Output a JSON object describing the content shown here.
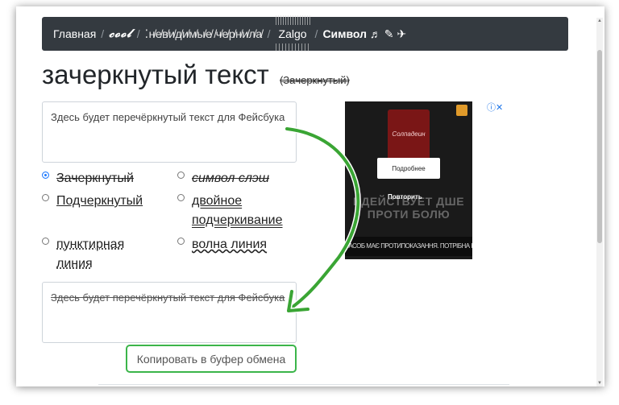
{
  "nav": {
    "home": "Главная",
    "sep": "/",
    "cool": "𝓬𝓸𝓸𝓵",
    "invisible_ink": "⁚н̸е̸в̸и̸д̸и̸м̸ы̸е̸ ̸ч̸е̸р̸н̸и̸л̸а̸",
    "zalgo": "Zalgo",
    "symbol": "Символ ♬ ✎ ✈"
  },
  "page": {
    "title": "зачеркнутый текст",
    "subtitle": "(̶З̶а̶ч̶е̶р̶к̶н̶у̶т̶ы̶й̶)"
  },
  "input": {
    "value": "Здесь будет перечёркнутый текст для Фейсбука"
  },
  "options": [
    {
      "label": "Зачеркнутый",
      "checked": true
    },
    {
      "label": "символ слэш",
      "checked": false
    },
    {
      "label": "Подчеркнутый",
      "checked": false
    },
    {
      "label": "двойное подчеркивание",
      "checked": false
    },
    {
      "label": "пунктирная линия",
      "checked": false
    },
    {
      "label": "волна линия",
      "checked": false
    }
  ],
  "output": {
    "value": "Здесь будет перечёркнутый текст для Фейсбука"
  },
  "copy_button": "Копировать в буфер обмена",
  "ad": {
    "brand": "Солпадеин",
    "more_button": "Подробнее",
    "repeat_button": "Повторить",
    "headline": "ВДЕЙСТВУЕТ ДШЕ ПРОТИ БОЛЮ",
    "strip": "ЗАСОБ МАЄ ПРОТИПОКАЗАННЯ. ПОТРІБНА КОНСУЛЬТАЦІЯ ЛІКАРЯ",
    "info_icon": "ⓘ✕"
  },
  "colors": {
    "navbar": "#343a40",
    "accent_green": "#3bb54a",
    "radio_checked": "#1f7aff"
  }
}
